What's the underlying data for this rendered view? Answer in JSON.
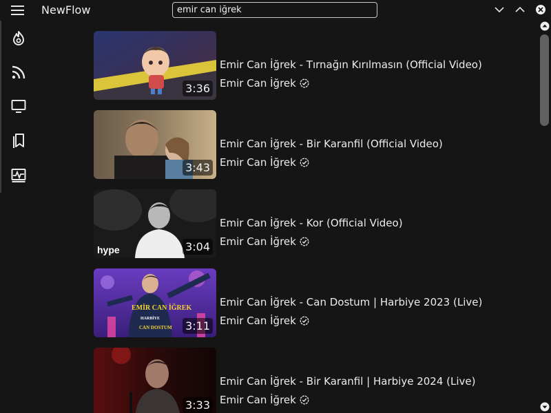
{
  "app": {
    "title": "NewFlow"
  },
  "search": {
    "value": "emir can iğrek"
  },
  "window_controls": [
    "chevron-down-icon",
    "chevron-up-icon",
    "close-icon"
  ],
  "sidebar": {
    "items": [
      {
        "name": "trending",
        "icon": "flame-icon"
      },
      {
        "name": "subscriptions",
        "icon": "rss-icon"
      },
      {
        "name": "channels",
        "icon": "monitor-icon"
      },
      {
        "name": "bookmarks",
        "icon": "bookmark-icon"
      },
      {
        "name": "activity",
        "icon": "activity-icon"
      }
    ]
  },
  "videos": [
    {
      "title": "Emir Can İğrek - Tırnağın Kırılmasın (Official Video)",
      "channel": "Emir Can İğrek",
      "duration": "3:36",
      "verified": true
    },
    {
      "title": "Emir Can İğrek - Bir Karanfil (Official Video)",
      "channel": "Emir Can İğrek",
      "duration": "3:43",
      "verified": true
    },
    {
      "title": "Emir Can İğrek - Kor (Official Video)",
      "channel": "Emir Can İğrek",
      "duration": "3:04",
      "verified": true,
      "thumb_logo": "hype"
    },
    {
      "title": "Emir Can İğrek - Can Dostum | Harbiye 2023 (Live)",
      "channel": "Emir Can İğrek",
      "duration": "3:11",
      "verified": true,
      "thumb_text": [
        "EMİR CAN İĞREK",
        "HARBİYE",
        "CAN DOSTUM"
      ]
    },
    {
      "title": "Emir Can İğrek - Bir Karanfil | Harbiye 2024 (Live)",
      "channel": "Emir Can İğrek",
      "duration": "3:33",
      "verified": true
    }
  ],
  "colors": {
    "background": "#161516",
    "text": "#ececec",
    "scrollbar": "#606060"
  }
}
